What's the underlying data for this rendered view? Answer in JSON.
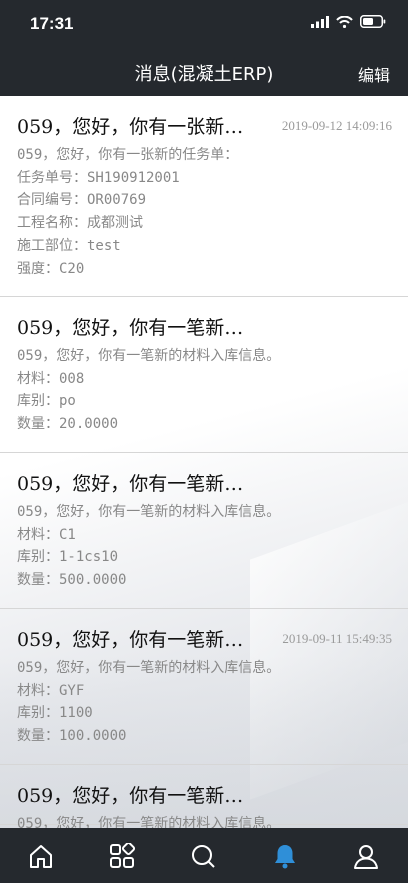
{
  "status": {
    "time": "17:31"
  },
  "nav": {
    "title": "消息(混凝土ERP)",
    "edit_label": "编辑"
  },
  "messages": [
    {
      "title": "059，您好，你有一张新…",
      "date": "2019-09-12 14:09:16",
      "lines": [
        "059，您好，你有一张新的任务单：",
        "任务单号：SH190912001",
        "合同编号：OR00769",
        "工程名称：成都测试",
        "施工部位：test",
        "强度：C20"
      ]
    },
    {
      "title": "059，您好，你有一笔新…",
      "date": "",
      "lines": [
        "059，您好，你有一笔新的材料入库信息。",
        "材料：008",
        "库别：po",
        "数量：20.0000"
      ]
    },
    {
      "title": "059，您好，你有一笔新…",
      "date": "",
      "lines": [
        "059，您好，你有一笔新的材料入库信息。",
        "材料：C1",
        "库别：1-1cs10",
        "数量：500.0000"
      ]
    },
    {
      "title": "059，您好，你有一笔新…",
      "date": "2019-09-11 15:49:35",
      "lines": [
        "059，您好，你有一笔新的材料入库信息。",
        "材料：GYF",
        "库别：1100",
        "数量：100.0000"
      ]
    },
    {
      "title": "059，您好，你有一笔新…",
      "date": "",
      "lines": [
        "059，您好，你有一笔新的材料入库信息。"
      ]
    }
  ],
  "tabs": [
    {
      "name": "home-icon",
      "active": false
    },
    {
      "name": "apps-grid-icon",
      "active": false
    },
    {
      "name": "search-icon",
      "active": false
    },
    {
      "name": "bell-icon",
      "active": true
    },
    {
      "name": "user-icon",
      "active": false
    }
  ],
  "colors": {
    "bar": "#25292e",
    "active_tab": "#2f8fd8",
    "inactive_tab": "#ffffff"
  }
}
